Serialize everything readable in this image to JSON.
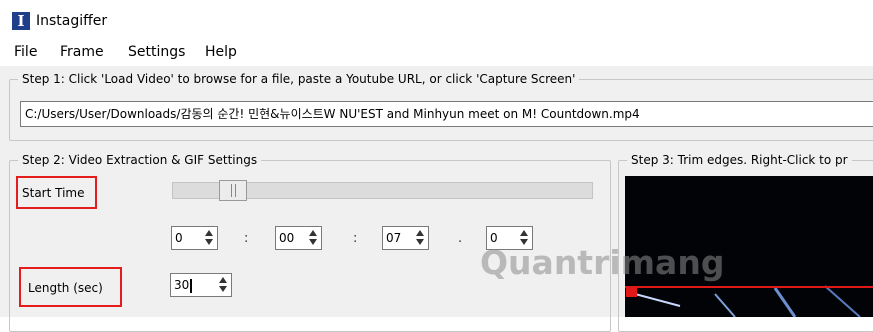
{
  "window": {
    "title": "Instagiffer",
    "icon_letter": "I"
  },
  "menu": [
    "File",
    "Frame",
    "Settings",
    "Help"
  ],
  "step1": {
    "legend": "Step 1: Click 'Load Video' to browse for a file, paste a Youtube URL, or click 'Capture Screen'",
    "file_path": "C:/Users/User/Downloads/감동의 순간! 민현&뉴이스트W NU'EST and Minhyun meet on M! Countdown.mp4"
  },
  "step2": {
    "legend": "Step 2: Video Extraction & GIF Settings",
    "start_time_label": "Start Time",
    "slider_position": 0.1,
    "time_fields": [
      "0",
      "00",
      "07",
      "0"
    ],
    "separators": [
      ":",
      ":",
      "."
    ],
    "length_label": "Length (sec)",
    "length_value": "30"
  },
  "step3": {
    "legend": "Step 3: Trim edges. Right-Click to pr"
  },
  "watermark": "Quantrimang",
  "colors": {
    "highlight": "#e41c1c",
    "preview_bg": "#020306"
  }
}
